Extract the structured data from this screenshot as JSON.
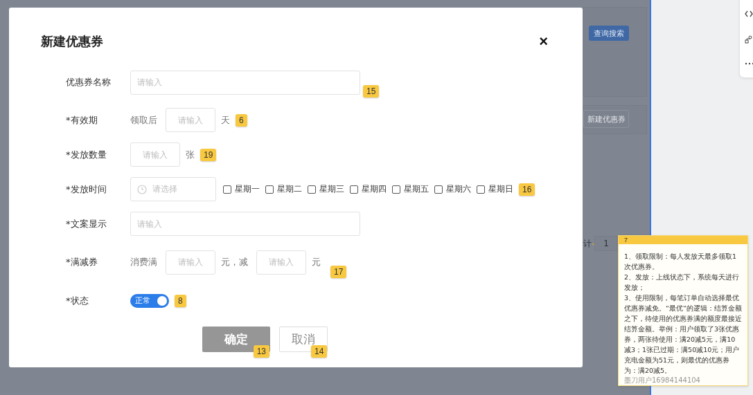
{
  "background": {
    "search_button": "查询搜索",
    "new_button": "新建优惠券",
    "pagination": {
      "label": "计",
      "page": "1"
    }
  },
  "dialog": {
    "title": "新建优惠券",
    "close": "×",
    "fields": [
      {
        "label": "优惠券名称",
        "badge": "15",
        "parts": [
          {
            "kind": "input",
            "placeholder": "请输入"
          }
        ]
      },
      {
        "label": "*有效期",
        "badge": "6",
        "parts": [
          {
            "kind": "text",
            "text": "领取后"
          },
          {
            "kind": "short_input",
            "placeholder": "请输入"
          },
          {
            "kind": "text",
            "text": "天"
          }
        ]
      },
      {
        "label": "*发放数量",
        "badge": "19",
        "parts": [
          {
            "kind": "short_input",
            "placeholder": "请输入"
          },
          {
            "kind": "text",
            "text": "张"
          }
        ]
      },
      {
        "label": "*发放时间",
        "badge": "16",
        "parts": [
          {
            "kind": "picker",
            "placeholder": "请选择"
          },
          {
            "kind": "checkbox",
            "text": "星期一",
            "checked": false
          },
          {
            "kind": "checkbox",
            "text": "星期二",
            "checked": false
          },
          {
            "kind": "checkbox",
            "text": "星期三",
            "checked": false
          },
          {
            "kind": "checkbox",
            "text": "星期四",
            "checked": false
          },
          {
            "kind": "checkbox",
            "text": "星期五",
            "checked": false
          },
          {
            "kind": "checkbox",
            "text": "星期六",
            "checked": false
          },
          {
            "kind": "checkbox",
            "text": "星期日",
            "checked": false
          }
        ]
      },
      {
        "label": "*文案显示",
        "parts": [
          {
            "kind": "input",
            "placeholder": "请输入"
          }
        ]
      },
      {
        "label": "*满减券",
        "badge": "17",
        "parts": [
          {
            "kind": "text",
            "text": "消费满"
          },
          {
            "kind": "short_input",
            "placeholder": "请输入"
          },
          {
            "kind": "text",
            "text": "元，减"
          },
          {
            "kind": "short_input",
            "placeholder": "请输入"
          },
          {
            "kind": "text",
            "text": "元"
          }
        ]
      },
      {
        "label": "*状态",
        "badge": "8",
        "parts": [
          {
            "kind": "toggle",
            "text": "正常",
            "on": true
          }
        ]
      }
    ],
    "buttons": [
      {
        "label": "确定",
        "kind": "primary",
        "badge": "13"
      },
      {
        "label": "取消",
        "kind": "default",
        "badge": "14"
      }
    ]
  },
  "note": {
    "number": "7",
    "paragraphs": [
      "1、领取限制：每人发放天最多领取1次优惠券。",
      "2、发放：上线状态下，系统每天进行发放；",
      "3、使用限制，每笔订单自动选择最优优惠券减免。“最优”的逻辑：结算金额之下，待使用的优惠券满的额度最接近结算金额。举例：用户领取了3张优惠券，两张待使用：满20减5元，满10减3；1张已过期：满50减10元；用户充电金额为51元，则最优的优惠券为：满20减5。"
    ],
    "author": "墨刀用户16984144104"
  }
}
